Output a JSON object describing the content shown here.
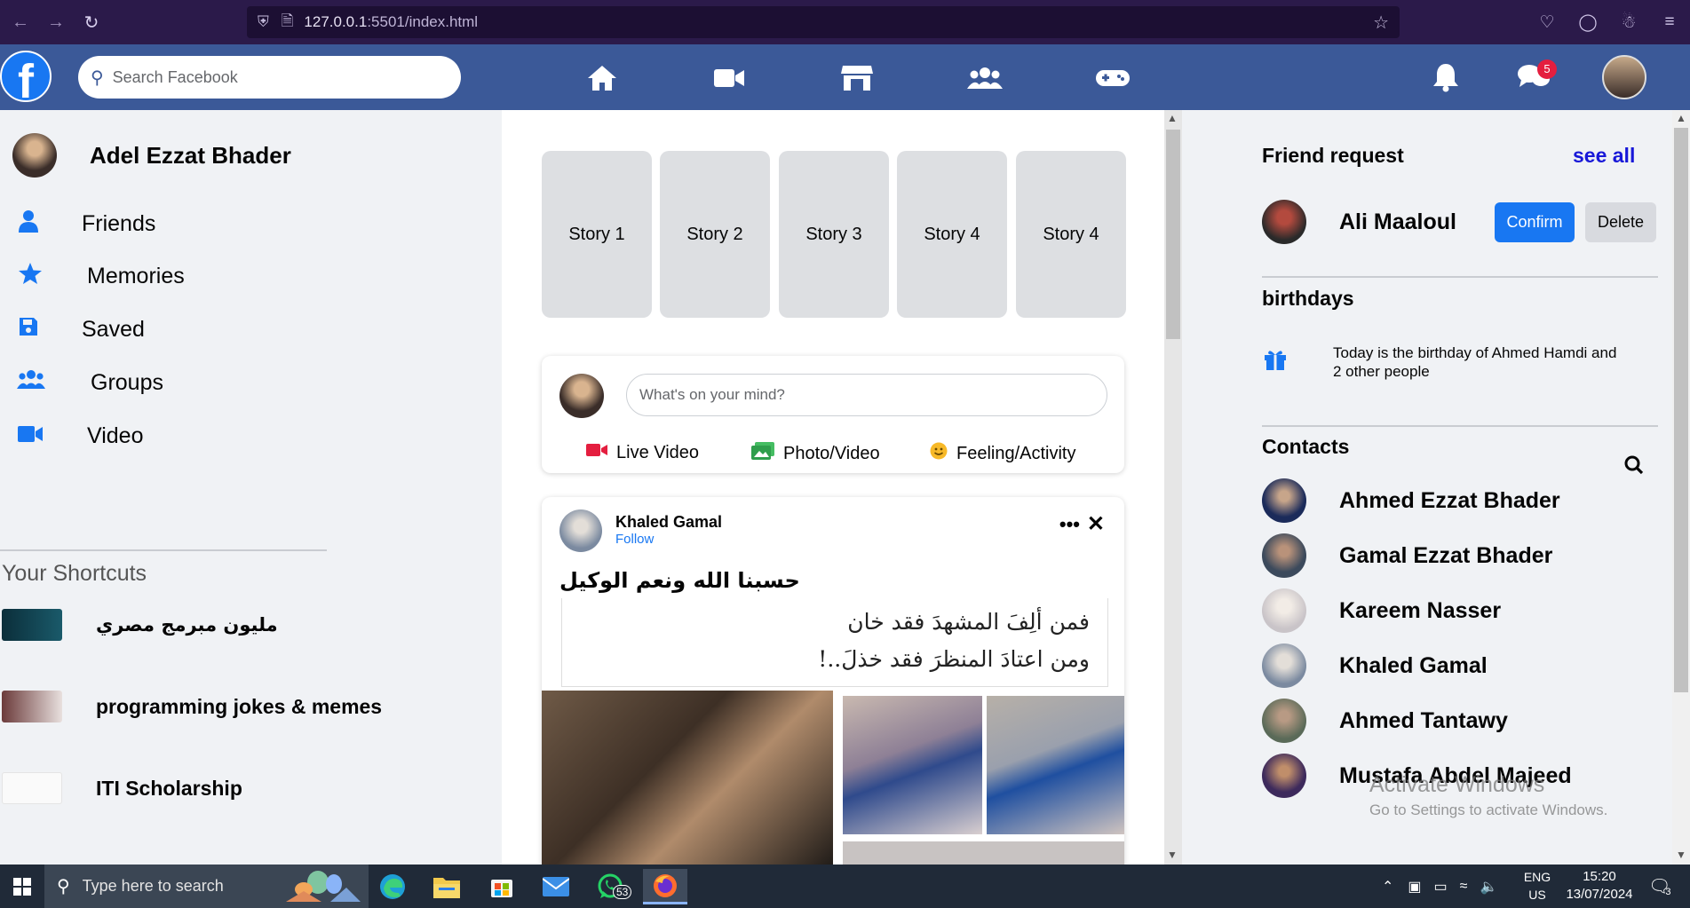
{
  "browser": {
    "url_host": "127.0.0.1",
    "url_path": ":5501/index.html"
  },
  "header": {
    "search_placeholder": "Search Facebook",
    "messages_badge": "5"
  },
  "left": {
    "profile_name": "Adel Ezzat Bhader",
    "menu": [
      {
        "label": "Friends",
        "icon": "user-icon"
      },
      {
        "label": "Memories",
        "icon": "star-icon"
      },
      {
        "label": "Saved",
        "icon": "save-icon"
      },
      {
        "label": "Groups",
        "icon": "users-icon"
      },
      {
        "label": "Video",
        "icon": "video-icon"
      }
    ],
    "shortcuts_title": "Your Shortcuts",
    "shortcuts": [
      {
        "label": "مليون مبرمج مصري"
      },
      {
        "label": "programming jokes & memes"
      },
      {
        "label": "ITI Scholarship"
      }
    ]
  },
  "feed": {
    "stories": [
      "Story 1",
      "Story 2",
      "Story 3",
      "Story 4",
      "Story 4"
    ],
    "composer_placeholder": "What's on your mind?",
    "actions": {
      "live": "Live Video",
      "photo": "Photo/Video",
      "feeling": "Feeling/Activity"
    },
    "post": {
      "author": "Khaled Gamal",
      "follow": "Follow",
      "text": "حسبنا الله ونعم الوكيل",
      "quote_line1": "فمن ألِفَ المشهدَ فقد خان",
      "quote_line2": "ومن اعتادَ المنظرَ فقد خذلَ..!"
    }
  },
  "right": {
    "friend_request_title": "Friend request",
    "see_all": "see all",
    "request": {
      "name": "Ali Maaloul",
      "confirm": "Confirm",
      "delete": "Delete"
    },
    "birthdays_title": "birthdays",
    "birthday_text": "Today is the birthday of Ahmed Hamdi and 2 other people",
    "contacts_title": "Contacts",
    "contacts": [
      {
        "name": "Ahmed Ezzat Bhader"
      },
      {
        "name": "Gamal Ezzat Bhader"
      },
      {
        "name": "Kareem Nasser"
      },
      {
        "name": "Khaled Gamal"
      },
      {
        "name": "Ahmed Tantawy"
      },
      {
        "name": "Mustafa Abdel Majeed"
      }
    ],
    "activate_title": "Activate Windows",
    "activate_sub": "Go to Settings to activate Windows."
  },
  "taskbar": {
    "search_placeholder": "Type here to search",
    "whatsapp_badge": "53",
    "lang": "ENG",
    "region": "US",
    "time": "15:20",
    "date": "13/07/2024",
    "notif_count": "3"
  }
}
